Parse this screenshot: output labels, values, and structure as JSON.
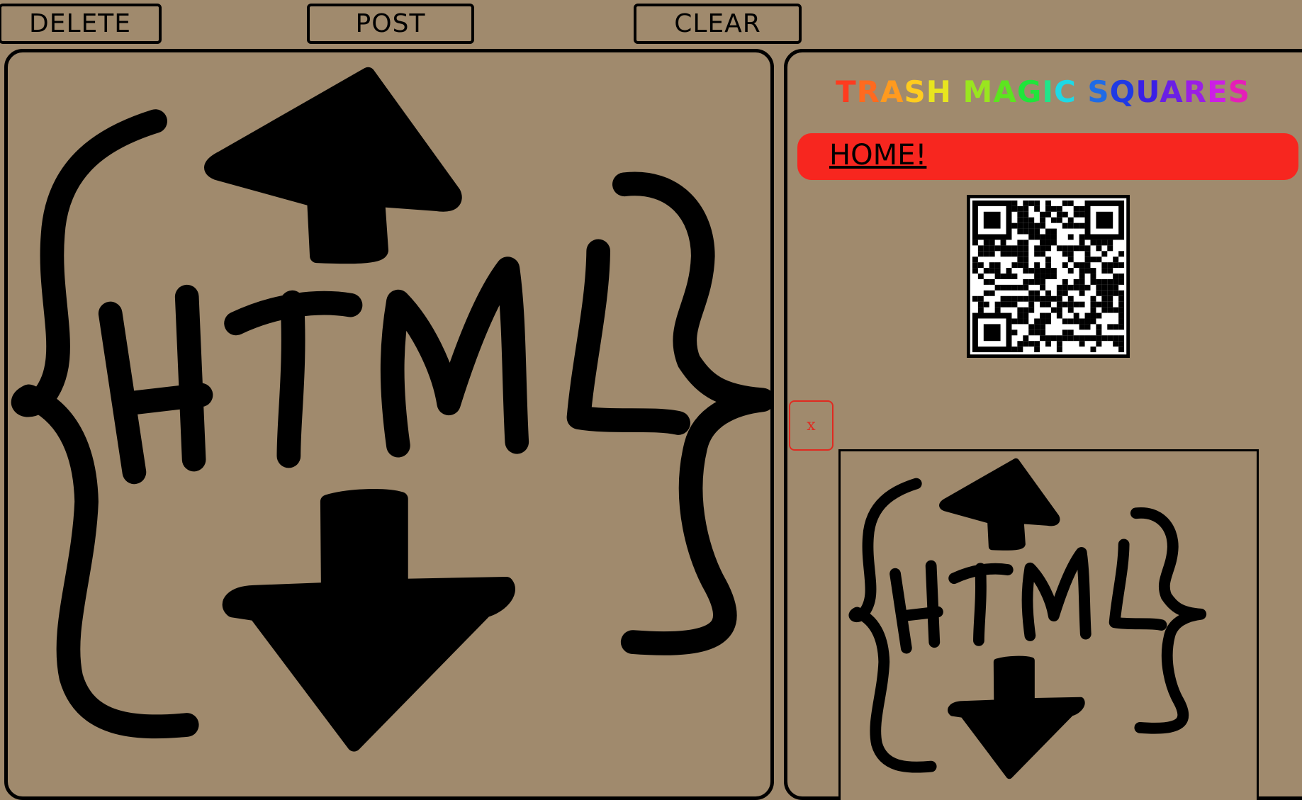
{
  "toolbar": {
    "delete_label": "DELETE",
    "post_label": "POST",
    "clear_label": "CLEAR"
  },
  "canvas": {
    "drawing_text": "HTML",
    "stroke_color": "#000000"
  },
  "sidebar": {
    "title_letters": [
      {
        "ch": "T",
        "color": "#ff3b1f"
      },
      {
        "ch": "R",
        "color": "#ff6a1f"
      },
      {
        "ch": "A",
        "color": "#ff9a1f"
      },
      {
        "ch": "S",
        "color": "#ffcc1f"
      },
      {
        "ch": "H",
        "color": "#e8e51f"
      },
      {
        "ch": " ",
        "color": "#000000"
      },
      {
        "ch": "M",
        "color": "#9ae51f"
      },
      {
        "ch": "A",
        "color": "#5ce51f"
      },
      {
        "ch": "G",
        "color": "#1fe53a"
      },
      {
        "ch": "I",
        "color": "#1fe58a"
      },
      {
        "ch": "C",
        "color": "#1fd9e5"
      },
      {
        "ch": " ",
        "color": "#000000"
      },
      {
        "ch": "S",
        "color": "#1f6be5"
      },
      {
        "ch": "Q",
        "color": "#1f3ae5"
      },
      {
        "ch": "U",
        "color": "#3a1fe5"
      },
      {
        "ch": "A",
        "color": "#6a1fe5"
      },
      {
        "ch": "R",
        "color": "#9a1fe5"
      },
      {
        "ch": "E",
        "color": "#cc1fe5"
      },
      {
        "ch": "S",
        "color": "#e51fb8"
      }
    ],
    "home_link": "HOME!",
    "home_bar_color": "#f7261f",
    "qr_icon": "qr-code-icon",
    "close_label": "x",
    "close_color": "#e02a20"
  },
  "colors": {
    "background": "#a08a6d",
    "border": "#000000"
  }
}
